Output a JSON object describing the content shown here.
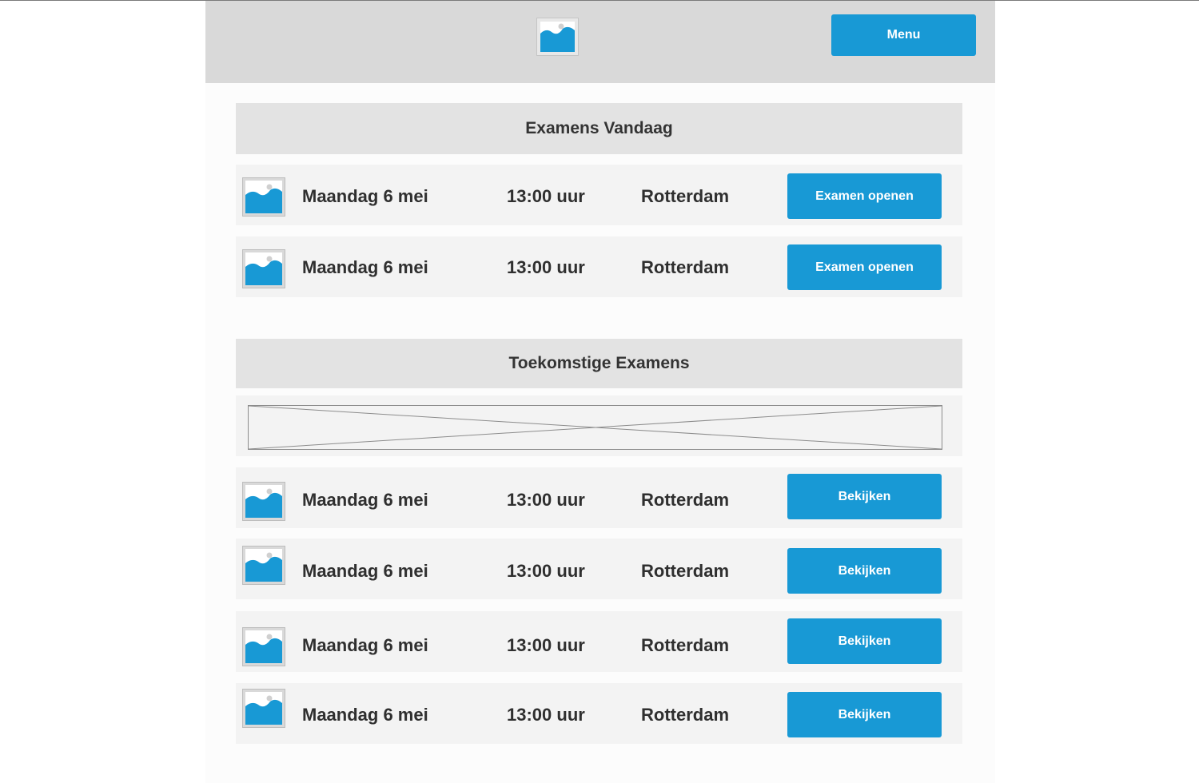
{
  "header": {
    "logo_icon": "image-placeholder-icon",
    "menu_label": "Menu"
  },
  "today": {
    "title": "Examens Vandaag",
    "rows": [
      {
        "date": "Maandag 6 mei",
        "time": "13:00 uur",
        "place": "Rotterdam",
        "action": "Examen openen",
        "icon": "image-placeholder-icon"
      },
      {
        "date": "Maandag 6 mei",
        "time": "13:00 uur",
        "place": "Rotterdam",
        "action": "Examen openen",
        "icon": "image-placeholder-icon"
      }
    ]
  },
  "upcoming": {
    "title": "Toekomstige Examens",
    "banner_icon": "image-placeholder-cross",
    "rows": [
      {
        "date": "Maandag 6 mei",
        "time": "13:00 uur",
        "place": "Rotterdam",
        "action": "Bekijken",
        "icon": "image-placeholder-icon"
      },
      {
        "date": "Maandag 6 mei",
        "time": "13:00 uur",
        "place": "Rotterdam",
        "action": "Bekijken",
        "icon": "image-placeholder-icon"
      },
      {
        "date": "Maandag 6 mei",
        "time": "13:00 uur",
        "place": "Rotterdam",
        "action": "Bekijken",
        "icon": "image-placeholder-icon"
      },
      {
        "date": "Maandag 6 mei",
        "time": "13:00 uur",
        "place": "Rotterdam",
        "action": "Bekijken",
        "icon": "image-placeholder-icon"
      }
    ]
  },
  "colors": {
    "accent": "#1899d5",
    "header_bg": "#d9d9d9",
    "section_bg": "#e3e3e3",
    "row_bg": "#f3f3f3",
    "text": "#2f2f2f"
  }
}
